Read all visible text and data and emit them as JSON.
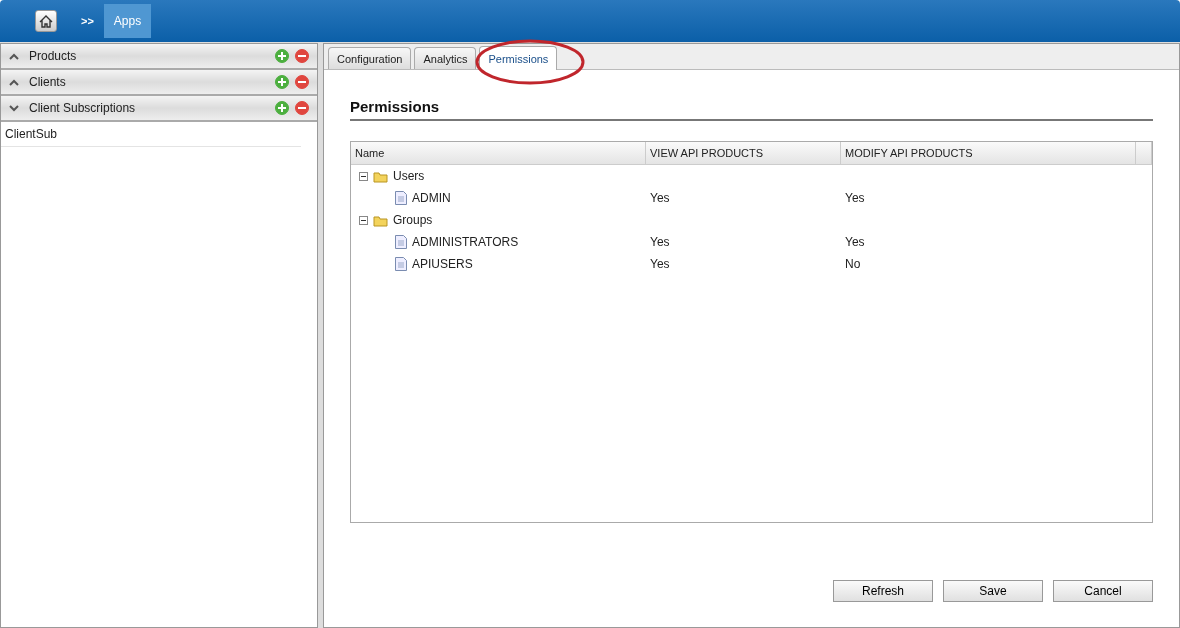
{
  "breadcrumb": {
    "separator": ">>",
    "items": [
      {
        "label": "Apps",
        "selected": true
      }
    ]
  },
  "sidebar": {
    "sections": [
      {
        "title": "Products",
        "expanded": false
      },
      {
        "title": "Clients",
        "expanded": false
      },
      {
        "title": "Client Subscriptions",
        "expanded": true,
        "items": [
          "ClientSub"
        ]
      }
    ]
  },
  "tabs": [
    {
      "label": "Configuration",
      "selected": false
    },
    {
      "label": "Analytics",
      "selected": false
    },
    {
      "label": "Permissions",
      "selected": true,
      "highlighted": true
    }
  ],
  "heading": "Permissions",
  "table": {
    "columns": [
      "Name",
      "VIEW API PRODUCTS",
      "MODIFY API PRODUCTS"
    ],
    "rows": [
      {
        "name": "Users",
        "expanded": true,
        "children": [
          {
            "name": "ADMIN",
            "view": "Yes",
            "modify": "Yes"
          }
        ]
      },
      {
        "name": "Groups",
        "expanded": true,
        "children": [
          {
            "name": "ADMINISTRATORS",
            "view": "Yes",
            "modify": "Yes"
          },
          {
            "name": "APIUSERS",
            "view": "Yes",
            "modify": "No"
          }
        ]
      }
    ]
  },
  "buttons": [
    "Refresh",
    "Save",
    "Cancel"
  ]
}
